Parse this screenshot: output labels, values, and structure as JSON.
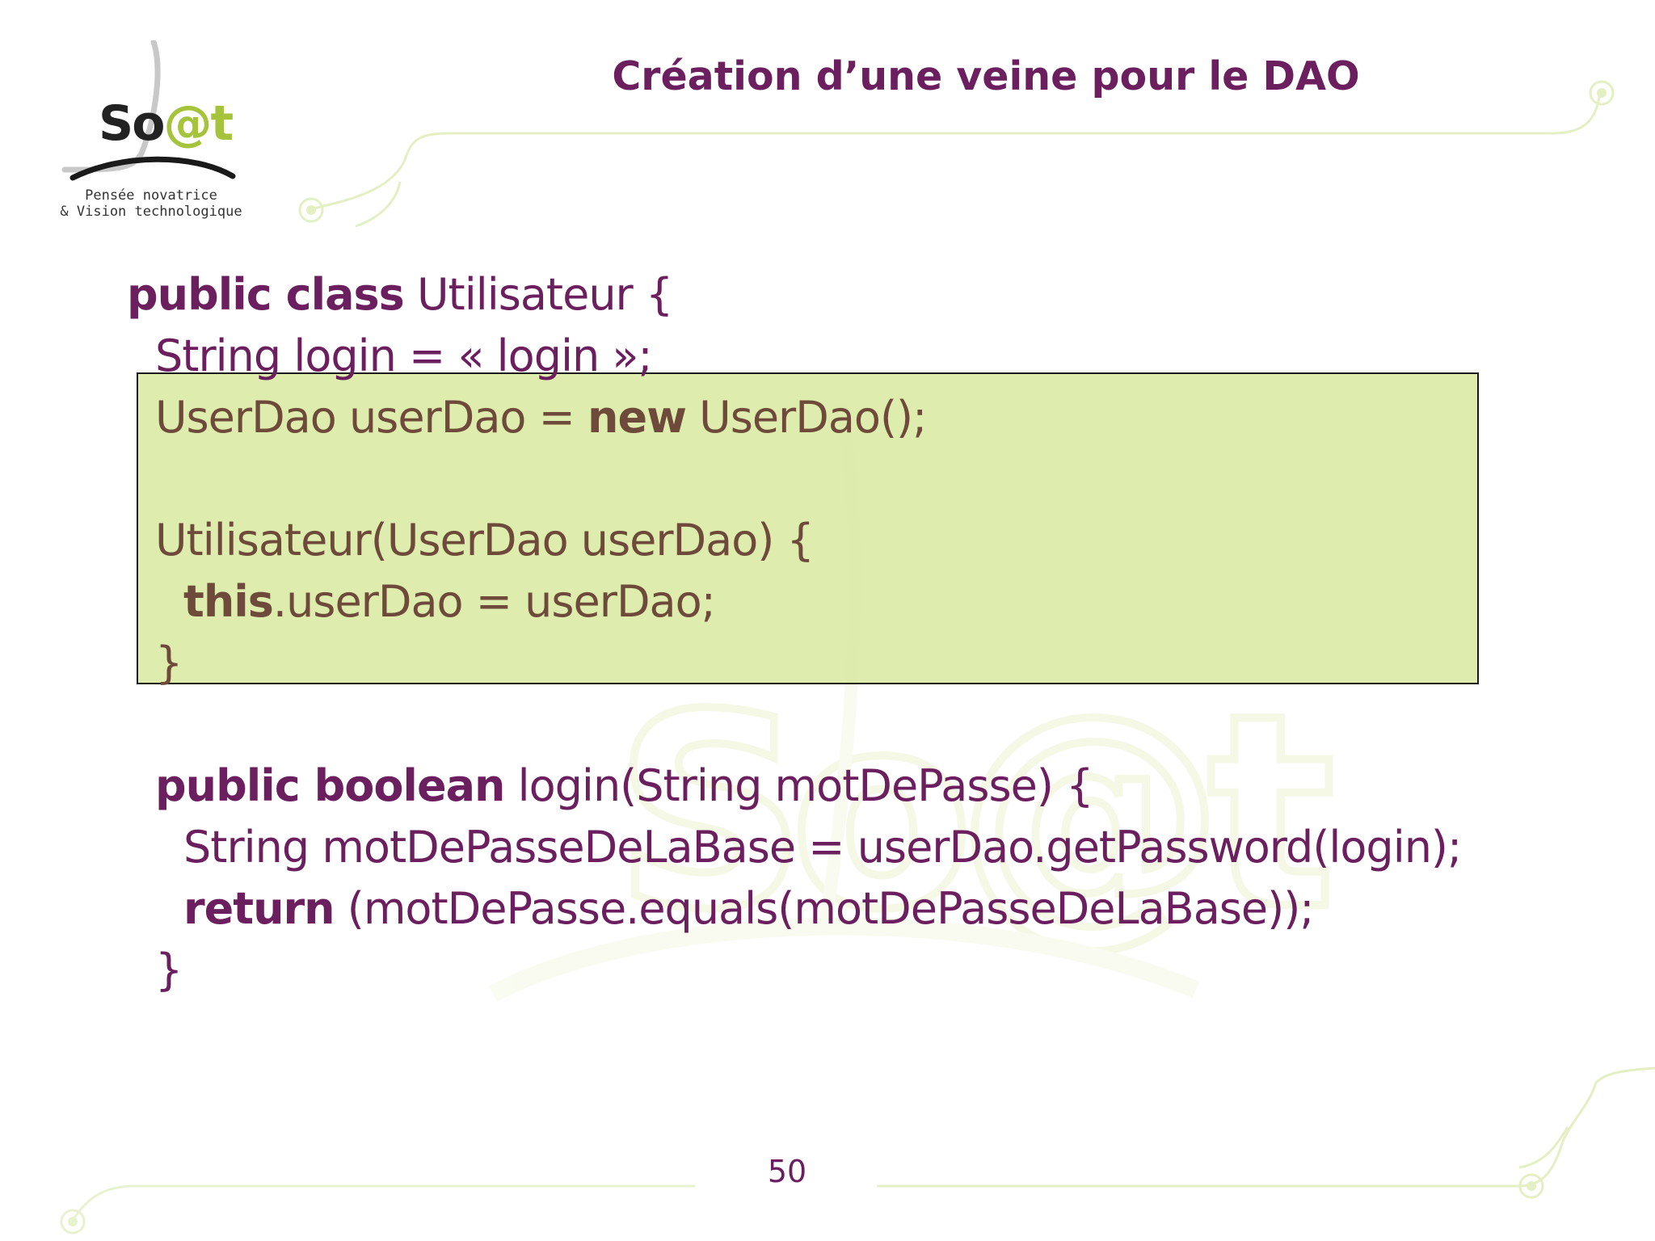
{
  "slide": {
    "title": "Création d’une veine pour le DAO",
    "page_number": "50"
  },
  "logo": {
    "name_prefix": "So",
    "name_at": "@",
    "name_suffix": "t",
    "tagline_1": "Pensée novatrice",
    "tagline_2": "& Vision technologique"
  },
  "code": {
    "line1_kw": "public class",
    "line1_rest": " Utilisateur {",
    "line2": "String login = « login »;",
    "line3_a": "UserDao userDao = ",
    "line3_kw": "new",
    "line3_b": " UserDao();",
    "line4": "Utilisateur(UserDao userDao) {",
    "line5_kw": "this",
    "line5_rest": ".userDao = userDao;",
    "line6": "}",
    "line7_kw": "public boolean",
    "line7_rest": " login(String motDePasse) {",
    "line8": "String motDePasseDeLaBase = userDao.getPassword(login);",
    "line9_kw": "return",
    "line9_rest": " (motDePasse.equals(motDePasseDeLaBase));",
    "line10": "}"
  },
  "colors": {
    "title": "#6b1f5f",
    "code": "#6b1f5f",
    "boxed_code": "#6e4a3a",
    "highlight_fill": "#d8e9a0",
    "decor_green": "#c8de8a"
  }
}
